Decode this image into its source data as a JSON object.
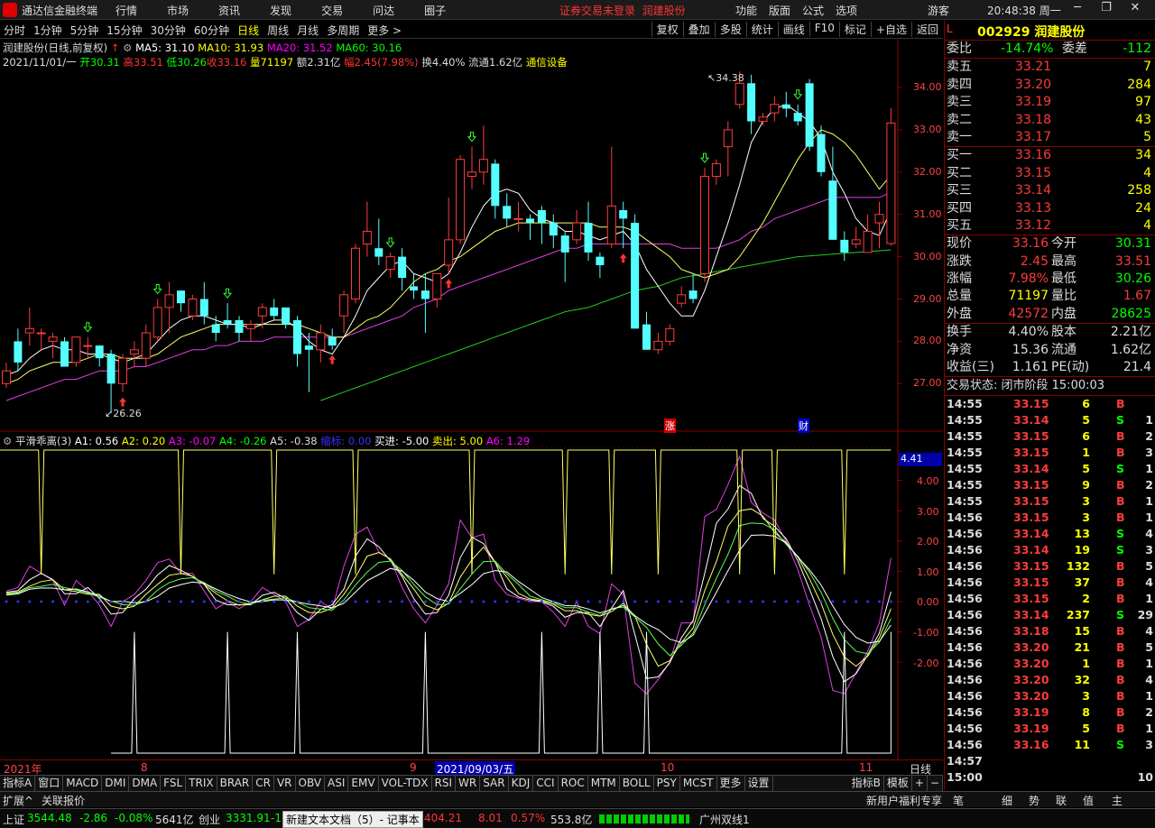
{
  "app": {
    "title": "通达信金融终端",
    "menus": [
      "行情",
      "市场",
      "资讯",
      "发现",
      "交易",
      "问达",
      "圈子"
    ],
    "warning": "证券交易未登录",
    "stock_link": "润建股份",
    "right_menus": [
      "功能",
      "版面",
      "公式",
      "选项"
    ],
    "user": "游客",
    "clock": "20:48:38 周一"
  },
  "tabs": [
    "分时",
    "1分钟",
    "5分钟",
    "15分钟",
    "30分钟",
    "60分钟",
    "日线",
    "周线",
    "月线",
    "多周期",
    "更多 >"
  ],
  "tools": [
    "复权",
    "叠加",
    "多股",
    "统计",
    "画线",
    "F10",
    "标记",
    "+自选",
    "返回"
  ],
  "chart": {
    "header": {
      "name": "润建股份(日线,前复权)",
      "ma5": "MA5: 31.10",
      "ma10": "MA10: 31.93",
      "ma20": "MA20: 31.52",
      "ma60": "MA60: 30.16"
    },
    "ohlc": {
      "date": "2021/11/01/一",
      "open": "开30.31",
      "high": "高33.51",
      "low": "低30.26",
      "close": "收33.16",
      "vol": "量71197",
      "amt": "额2.31亿",
      "chg": "幅2.45(7.98%)",
      "turn": "换4.40%",
      "float": "流通1.62亿",
      "sector": "通信设备"
    },
    "price_labels": [
      "34.00",
      "33.00",
      "32.00",
      "31.00",
      "30.00",
      "29.00",
      "28.00",
      "27.00"
    ],
    "max_label": "34.38",
    "min_label": "26.26",
    "events": [
      "涨",
      "财"
    ],
    "candles": [
      [
        27.0,
        27.5,
        26.9,
        27.3
      ],
      [
        28.0,
        28.3,
        27.3,
        27.5
      ],
      [
        28.2,
        28.8,
        27.9,
        28.3
      ],
      [
        28.2,
        28.3,
        27.8,
        28.2
      ],
      [
        28.0,
        28.2,
        27.6,
        28.1
      ],
      [
        28.0,
        28.1,
        27.4,
        27.4
      ],
      [
        27.5,
        28.1,
        27.4,
        28.1
      ],
      [
        27.9,
        28.1,
        27.6,
        27.9
      ],
      [
        27.9,
        27.9,
        27.4,
        27.6
      ],
      [
        27.7,
        27.8,
        26.3,
        27.0
      ],
      [
        27.0,
        27.7,
        26.8,
        27.6
      ],
      [
        27.7,
        28.0,
        27.4,
        27.8
      ],
      [
        27.6,
        28.4,
        27.4,
        28.2
      ],
      [
        28.1,
        29.0,
        28.0,
        28.8
      ],
      [
        28.8,
        29.4,
        28.2,
        29.1
      ],
      [
        29.2,
        29.2,
        28.7,
        28.9
      ],
      [
        28.6,
        29.1,
        28.5,
        29.0
      ],
      [
        29.0,
        29.4,
        28.4,
        28.6
      ],
      [
        28.4,
        28.6,
        28.0,
        28.2
      ],
      [
        28.5,
        28.9,
        28.3,
        28.4
      ],
      [
        28.5,
        28.6,
        28.0,
        28.2
      ],
      [
        28.3,
        28.5,
        28.0,
        28.4
      ],
      [
        28.6,
        28.9,
        28.3,
        28.8
      ],
      [
        28.8,
        29.0,
        28.5,
        28.6
      ],
      [
        28.8,
        28.8,
        28.3,
        28.4
      ],
      [
        28.5,
        28.6,
        27.4,
        27.7
      ],
      [
        27.9,
        28.2,
        26.8,
        27.8
      ],
      [
        27.8,
        28.4,
        27.5,
        28.2
      ],
      [
        28.1,
        28.3,
        27.8,
        27.9
      ],
      [
        28.6,
        29.2,
        28.2,
        29.1
      ],
      [
        29.0,
        30.3,
        28.9,
        30.2
      ],
      [
        30.3,
        31.3,
        30.0,
        30.6
      ],
      [
        30.2,
        30.9,
        29.8,
        30.0
      ],
      [
        29.7,
        30.1,
        29.5,
        30.0
      ],
      [
        30.0,
        30.2,
        29.2,
        29.5
      ],
      [
        29.3,
        29.6,
        29.0,
        29.2
      ],
      [
        29.2,
        29.6,
        28.2,
        29.0
      ],
      [
        29.0,
        29.6,
        28.8,
        29.6
      ],
      [
        29.8,
        31.4,
        29.6,
        30.4
      ],
      [
        30.4,
        32.4,
        30.3,
        32.3
      ],
      [
        31.9,
        32.6,
        31.6,
        32.0
      ],
      [
        32.0,
        33.1,
        31.7,
        32.3
      ],
      [
        32.2,
        32.3,
        30.9,
        31.2
      ],
      [
        31.2,
        31.5,
        30.7,
        30.9
      ],
      [
        30.9,
        31.3,
        30.6,
        30.9
      ],
      [
        30.9,
        31.0,
        30.4,
        30.8
      ],
      [
        31.1,
        31.2,
        30.3,
        30.8
      ],
      [
        30.8,
        31.0,
        30.2,
        30.5
      ],
      [
        30.5,
        30.6,
        29.4,
        30.1
      ],
      [
        30.4,
        31.1,
        30.3,
        30.8
      ],
      [
        30.8,
        31.3,
        29.9,
        30.1
      ],
      [
        30.0,
        30.1,
        29.5,
        29.8
      ],
      [
        30.3,
        32.6,
        30.2,
        31.2
      ],
      [
        31.1,
        31.3,
        30.2,
        30.9
      ],
      [
        30.8,
        31.0,
        28.6,
        28.3
      ],
      [
        28.4,
        28.7,
        27.8,
        27.8
      ],
      [
        27.8,
        28.2,
        27.7,
        28.0
      ],
      [
        28.0,
        28.4,
        27.9,
        28.3
      ],
      [
        28.9,
        29.3,
        28.8,
        29.1
      ],
      [
        29.2,
        29.6,
        28.9,
        29.0
      ],
      [
        29.6,
        32.1,
        29.4,
        31.9
      ],
      [
        31.9,
        32.3,
        31.7,
        32.2
      ],
      [
        32.6,
        33.2,
        31.9,
        33.0
      ],
      [
        33.6,
        34.38,
        33.5,
        34.1
      ],
      [
        34.1,
        34.3,
        32.9,
        33.2
      ],
      [
        33.2,
        33.4,
        33.1,
        33.3
      ],
      [
        33.4,
        33.8,
        33.2,
        33.6
      ],
      [
        33.6,
        33.9,
        33.3,
        33.5
      ],
      [
        33.4,
        33.6,
        33.1,
        33.2
      ],
      [
        34.1,
        34.2,
        32.5,
        32.6
      ],
      [
        32.9,
        33.1,
        31.9,
        32.0
      ],
      [
        31.8,
        32.6,
        30.4,
        30.4
      ],
      [
        30.4,
        30.6,
        29.9,
        30.1
      ],
      [
        30.3,
        30.7,
        30.2,
        30.4
      ],
      [
        30.1,
        31.0,
        30.1,
        30.6
      ],
      [
        30.8,
        31.3,
        30.2,
        31.0
      ],
      [
        30.31,
        33.51,
        30.26,
        33.16
      ]
    ],
    "ma5": [
      27.2,
      27.3,
      27.6,
      27.8,
      27.9,
      27.8,
      27.8,
      27.7,
      27.7,
      27.6,
      27.5,
      27.6,
      27.7,
      28.0,
      28.3,
      28.5,
      28.6,
      28.6,
      28.5,
      28.4,
      28.4,
      28.3,
      28.4,
      28.5,
      28.5,
      28.3,
      28.0,
      27.8,
      27.7,
      28.1,
      28.6,
      29.2,
      29.5,
      29.8,
      29.9,
      29.6,
      29.5,
      29.4,
      29.6,
      30.1,
      30.7,
      31.2,
      31.5,
      31.6,
      31.5,
      31.1,
      30.9,
      30.8,
      30.6,
      30.6,
      30.5,
      30.4,
      30.5,
      30.6,
      30.3,
      29.7,
      29.3,
      28.9,
      28.6,
      28.6,
      29.2,
      30.0,
      30.8,
      31.7,
      32.7,
      33.2,
      33.5,
      33.6,
      33.4,
      33.2,
      32.8,
      32.0,
      31.5,
      30.9,
      30.6,
      30.5,
      31.1
    ],
    "ma10": [
      27.0,
      27.1,
      27.3,
      27.4,
      27.5,
      27.5,
      27.5,
      27.6,
      27.7,
      27.7,
      27.6,
      27.6,
      27.6,
      27.7,
      27.9,
      28.1,
      28.2,
      28.3,
      28.4,
      28.4,
      28.4,
      28.4,
      28.4,
      28.4,
      28.4,
      28.4,
      28.3,
      28.2,
      28.1,
      28.1,
      28.3,
      28.5,
      28.6,
      28.8,
      29.1,
      29.4,
      29.6,
      29.7,
      29.9,
      30.0,
      30.2,
      30.4,
      30.6,
      30.7,
      30.8,
      30.8,
      30.8,
      30.8,
      30.8,
      30.8,
      30.8,
      30.7,
      30.7,
      30.7,
      30.6,
      30.4,
      30.2,
      30.0,
      29.7,
      29.6,
      29.5,
      29.6,
      29.7,
      30.0,
      30.4,
      30.8,
      31.3,
      31.8,
      32.3,
      32.7,
      33.0,
      32.9,
      32.7,
      32.4,
      32.0,
      31.6,
      31.93
    ],
    "ma20": [
      26.6,
      26.7,
      26.8,
      26.9,
      27.0,
      27.1,
      27.1,
      27.2,
      27.3,
      27.3,
      27.3,
      27.4,
      27.4,
      27.5,
      27.6,
      27.7,
      27.8,
      27.8,
      27.9,
      27.9,
      28.0,
      28.0,
      28.0,
      28.1,
      28.1,
      28.1,
      28.1,
      28.1,
      28.1,
      28.1,
      28.2,
      28.3,
      28.4,
      28.5,
      28.6,
      28.8,
      28.9,
      29.0,
      29.2,
      29.3,
      29.4,
      29.5,
      29.6,
      29.7,
      29.8,
      29.9,
      30.0,
      30.1,
      30.2,
      30.2,
      30.3,
      30.3,
      30.3,
      30.3,
      30.3,
      30.3,
      30.3,
      30.3,
      30.2,
      30.2,
      30.2,
      30.2,
      30.3,
      30.4,
      30.6,
      30.7,
      30.9,
      31.0,
      31.1,
      31.2,
      31.3,
      31.4,
      31.4,
      31.4,
      31.4,
      31.4,
      31.52
    ],
    "ma60": [
      null,
      null,
      null,
      null,
      null,
      null,
      null,
      null,
      null,
      null,
      null,
      null,
      null,
      null,
      null,
      null,
      null,
      null,
      null,
      null,
      null,
      null,
      null,
      null,
      null,
      null,
      null,
      26.6,
      26.7,
      26.8,
      26.9,
      27.0,
      27.1,
      27.2,
      27.3,
      27.4,
      27.5,
      27.6,
      27.7,
      27.8,
      27.9,
      28.0,
      28.1,
      28.2,
      28.3,
      28.4,
      28.5,
      28.6,
      28.7,
      28.75,
      28.8,
      28.9,
      29.0,
      29.1,
      29.2,
      29.25,
      29.3,
      29.4,
      29.5,
      29.55,
      29.6,
      29.65,
      29.7,
      29.75,
      29.8,
      29.85,
      29.9,
      29.95,
      30.0,
      30.02,
      30.04,
      30.06,
      30.08,
      30.1,
      30.12,
      30.14,
      30.16
    ],
    "arrows_up": [
      10,
      28,
      38,
      53
    ],
    "arrows_down": [
      7,
      13,
      19,
      33,
      40,
      60,
      68
    ],
    "x_labels": [
      "2021年",
      "8",
      "9",
      "2021/09/03/五",
      "10",
      "11",
      "日线"
    ]
  },
  "osc": {
    "name": "平滑乖离(3)",
    "a1": "A1: 0.56",
    "a2": "A2: 0.20",
    "a3": "A3: -0.07",
    "a4": "A4: -0.26",
    "a5": "A5: -0.38",
    "a5_t": "缩标: 0.00",
    "buy": "买进: -5.00",
    "sell": "卖出: 5.00",
    "a6": "A6: 1.29",
    "axis": [
      "4.41",
      "4.00",
      "3.00",
      "2.00",
      "1.00",
      "0.00",
      "-1.00",
      "-2.00"
    ]
  },
  "indicator_tabs": [
    "指标A",
    "窗口",
    "MACD",
    "DMI",
    "DMA",
    "FSL",
    "TRIX",
    "BRAR",
    "CR",
    "VR",
    "OBV",
    "ASI",
    "EMV",
    "VOL-TDX",
    "RSI",
    "WR",
    "SAR",
    "KDJ",
    "CCI",
    "ROC",
    "MTM",
    "BOLL",
    "PSY",
    "MCST",
    "更多",
    "设置"
  ],
  "indicator_right": [
    "指标B",
    "模板",
    "+",
    "−"
  ],
  "expand": {
    "left": "扩展^",
    "quote": "关联报价",
    "promo": "新用户福利专享",
    "tabs": [
      "笔",
      "细",
      "势",
      "联",
      "值",
      "主"
    ]
  },
  "status": {
    "sh_name": "上证",
    "sh": "3544.48",
    "sh_chg": "-2.86",
    "sh_pct": "-0.08%",
    "sh_amt": "5641亿",
    "cy_name": "创业",
    "cy": "3331.91",
    "cy_chg": "-1",
    "doc": "新建文本文档（5）- 记事本",
    "v2": "404.21",
    "v2_chg": "8.01",
    "v2_pct": "0.57%",
    "v2_amt": "553.8亿",
    "city": "广州双线1"
  },
  "quote": {
    "code": "002929",
    "name": "润建股份",
    "l": "L",
    "weibi": {
      "label": "委比",
      "value": "-14.74%",
      "label2": "委差",
      "value2": "-112"
    },
    "asks": [
      {
        "label": "卖五",
        "price": "33.21",
        "vol": "7"
      },
      {
        "label": "卖四",
        "price": "33.20",
        "vol": "284"
      },
      {
        "label": "卖三",
        "price": "33.19",
        "vol": "97"
      },
      {
        "label": "卖二",
        "price": "33.18",
        "vol": "43"
      },
      {
        "label": "卖一",
        "price": "33.17",
        "vol": "5"
      }
    ],
    "bids": [
      {
        "label": "买一",
        "price": "33.16",
        "vol": "34"
      },
      {
        "label": "买二",
        "price": "33.15",
        "vol": "4"
      },
      {
        "label": "买三",
        "price": "33.14",
        "vol": "258"
      },
      {
        "label": "买四",
        "price": "33.13",
        "vol": "24"
      },
      {
        "label": "买五",
        "price": "33.12",
        "vol": "4"
      }
    ],
    "stats": [
      [
        "现价",
        "33.16",
        "今开",
        "30.31"
      ],
      [
        "涨跌",
        "2.45",
        "最高",
        "33.51"
      ],
      [
        "涨幅",
        "7.98%",
        "最低",
        "30.26"
      ],
      [
        "总量",
        "71197",
        "量比",
        "1.67"
      ],
      [
        "外盘",
        "42572",
        "内盘",
        "28625"
      ]
    ],
    "stats2": [
      [
        "换手",
        "4.40%",
        "股本",
        "2.21亿"
      ],
      [
        "净资",
        "15.36",
        "流通",
        "1.62亿"
      ],
      [
        "收益(三)",
        "1.161",
        "PE(动)",
        "21.4"
      ]
    ],
    "trade_status": "交易状态: 闭市阶段 15:00:03",
    "trades": [
      [
        "14:55",
        "33.15",
        "6",
        "B",
        ""
      ],
      [
        "14:55",
        "33.14",
        "5",
        "S",
        "1"
      ],
      [
        "14:55",
        "33.15",
        "6",
        "B",
        "2"
      ],
      [
        "14:55",
        "33.15",
        "1",
        "B",
        "3"
      ],
      [
        "14:55",
        "33.14",
        "5",
        "S",
        "1"
      ],
      [
        "14:55",
        "33.15",
        "9",
        "B",
        "2"
      ],
      [
        "14:55",
        "33.15",
        "3",
        "B",
        "1"
      ],
      [
        "14:56",
        "33.15",
        "3",
        "B",
        "1"
      ],
      [
        "14:56",
        "33.14",
        "13",
        "S",
        "4"
      ],
      [
        "14:56",
        "33.14",
        "19",
        "S",
        "3"
      ],
      [
        "14:56",
        "33.15",
        "132",
        "B",
        "5"
      ],
      [
        "14:56",
        "33.15",
        "37",
        "B",
        "4"
      ],
      [
        "14:56",
        "33.15",
        "2",
        "B",
        "1"
      ],
      [
        "14:56",
        "33.14",
        "237",
        "S",
        "29"
      ],
      [
        "14:56",
        "33.18",
        "15",
        "B",
        "4"
      ],
      [
        "14:56",
        "33.20",
        "21",
        "B",
        "5"
      ],
      [
        "14:56",
        "33.20",
        "1",
        "B",
        "1"
      ],
      [
        "14:56",
        "33.20",
        "32",
        "B",
        "4"
      ],
      [
        "14:56",
        "33.20",
        "3",
        "B",
        "1"
      ],
      [
        "14:56",
        "33.19",
        "8",
        "B",
        "2"
      ],
      [
        "14:56",
        "33.19",
        "5",
        "B",
        "1"
      ],
      [
        "14:56",
        "33.16",
        "11",
        "S",
        "3"
      ],
      [
        "14:57",
        "",
        "",
        "",
        ""
      ],
      [
        "15:00",
        "",
        "",
        "",
        "10"
      ]
    ]
  }
}
